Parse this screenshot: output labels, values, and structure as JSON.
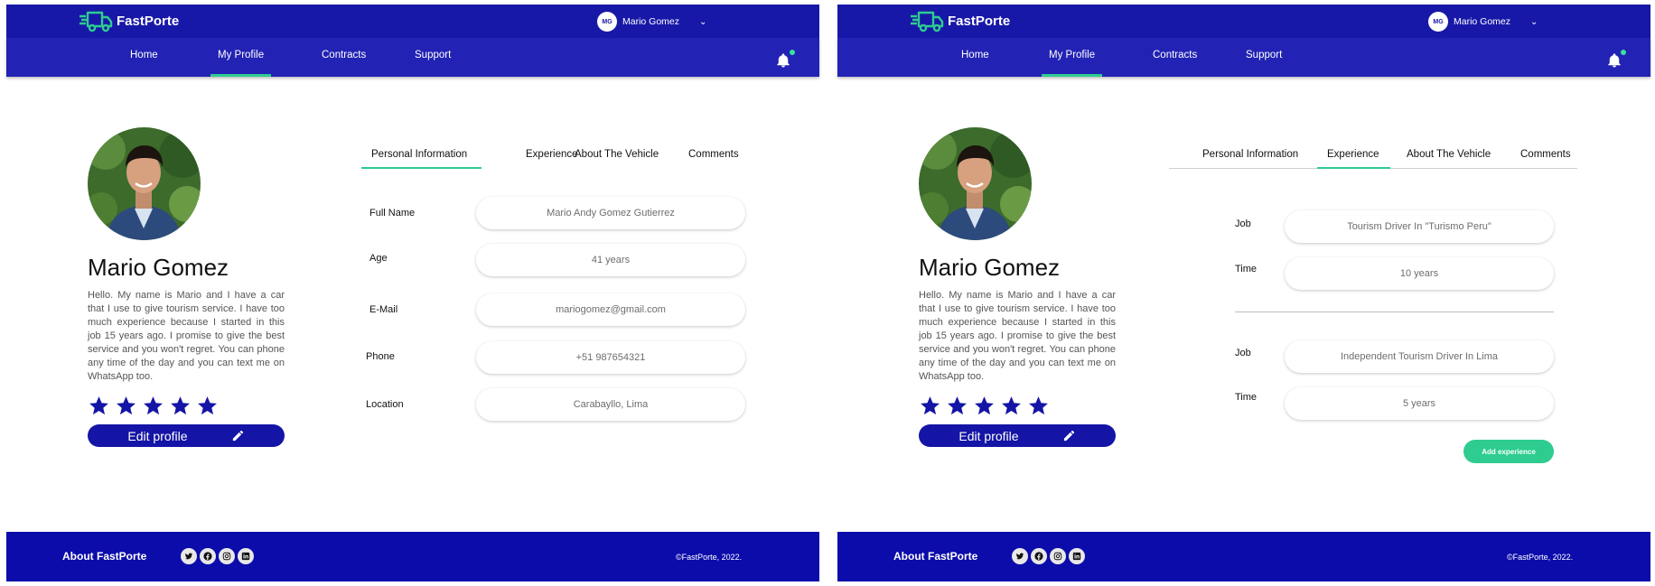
{
  "brand": {
    "name": "FastPorte"
  },
  "user": {
    "initials": "MG",
    "name": "Mario Gomez"
  },
  "nav": {
    "items": [
      "Home",
      "My Profile",
      "Contracts",
      "Support"
    ],
    "active": "My Profile"
  },
  "profile": {
    "name": "Mario Gomez",
    "bio": "Hello. My name is Mario and I have a car that I use to give tourism service. I have too much experience because I started in this job 15 years ago. I promise to give the best service and you won't regret. You can phone any time of the day and you can text me on WhatsApp too.",
    "rating": 5,
    "edit_label": "Edit profile"
  },
  "tabs": [
    "Personal Information",
    "Experience",
    "About The Vehicle",
    "Comments"
  ],
  "personal_info": {
    "active_tab": "Personal Information",
    "fields": [
      {
        "label": "Full Name",
        "value": "Mario Andy Gomez Gutierrez"
      },
      {
        "label": "Age",
        "value": "41 years"
      },
      {
        "label": "E-Mail",
        "value": "mariogomez@gmail.com"
      },
      {
        "label": "Phone",
        "value": "+51 987654321"
      },
      {
        "label": "Location",
        "value": "Carabayllo, Lima"
      }
    ]
  },
  "experience": {
    "active_tab": "Experience",
    "entries": [
      {
        "job_label": "Job",
        "job": "Tourism Driver In \"Turismo Peru\"",
        "time_label": "Time",
        "time": "10 years"
      },
      {
        "job_label": "Job",
        "job": "Independent Tourism Driver In Lima",
        "time_label": "Time",
        "time": "5 years"
      }
    ],
    "add_label": "Add experience"
  },
  "footer": {
    "title": "About FastPorte",
    "socials": [
      "twitter",
      "facebook",
      "instagram",
      "linkedin"
    ],
    "copyright": "©FastPorte, 2022."
  },
  "colors": {
    "header": "#1818a8",
    "nav": "#2222b4",
    "accent": "#2ecc8f",
    "footer": "#0c0cab",
    "star": "#1414a6"
  }
}
